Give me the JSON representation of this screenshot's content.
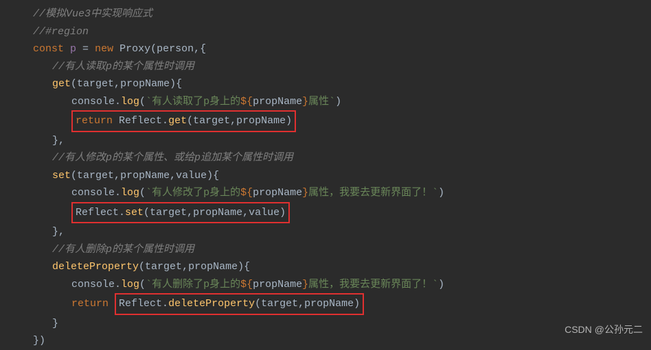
{
  "code": {
    "c1": "//模拟Vue3中实现响应式",
    "c2": "//#region",
    "kw_const": "const",
    "var_p": "p",
    "eq": " = ",
    "kw_new": "new",
    "cls_proxy": "Proxy",
    "arg_person": "person",
    "c3": "//有人读取p的某个属性时调用",
    "fn_get": "get",
    "params_tp": "target",
    "params_pn": "propName",
    "obj_console": "console",
    "fn_log": "log",
    "str_get_pre": "`有人读取了p身上的",
    "tmpl_open": "${",
    "tmpl_close": "}",
    "str_get_suf": "属性`",
    "kw_return": "return",
    "obj_reflect": "Reflect",
    "fn_rget": "get",
    "c4": "//有人修改p的某个属性、或给p追加某个属性时调用",
    "fn_set": "set",
    "params_val": "value",
    "str_set_pre": "`有人修改了p身上的",
    "str_set_suf": "属性，我要去更新界面了！`",
    "fn_rset": "set",
    "c5": "//有人删除p的某个属性时调用",
    "fn_del": "deleteProperty",
    "str_del_pre": "`有人删除了p身上的",
    "str_del_suf": "属性，我要去更新界面了！`",
    "fn_rdel": "deleteProperty"
  },
  "watermark": "CSDN @公孙元二"
}
